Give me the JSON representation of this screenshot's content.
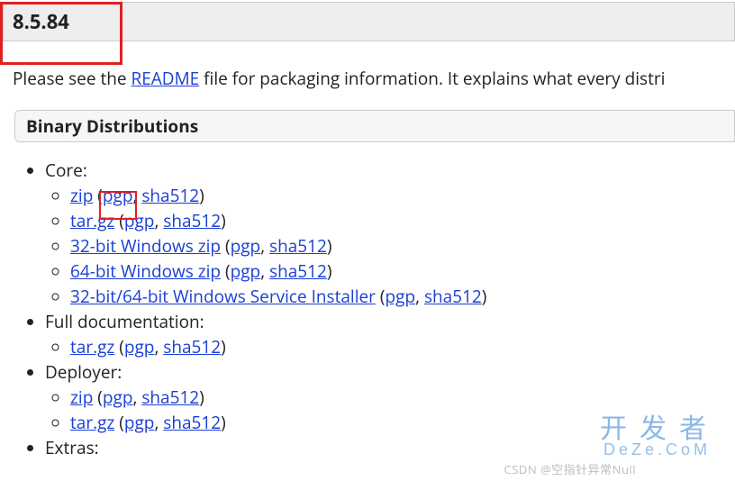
{
  "version": "8.5.84",
  "intro_prefix": "Please see the ",
  "intro_link": "README",
  "intro_suffix": " file for packaging information. It explains what every distri",
  "section_title": "Binary Distributions",
  "labels": {
    "pgp": "pgp",
    "sha512": "sha512"
  },
  "groups": [
    {
      "label": "Core:",
      "items": [
        {
          "name": "zip"
        },
        {
          "name": "tar.gz"
        },
        {
          "name": "32-bit Windows zip"
        },
        {
          "name": "64-bit Windows zip"
        },
        {
          "name": "32-bit/64-bit Windows Service Installer"
        }
      ]
    },
    {
      "label": "Full documentation:",
      "items": [
        {
          "name": "tar.gz"
        }
      ]
    },
    {
      "label": "Deployer:",
      "items": [
        {
          "name": "zip"
        },
        {
          "name": "tar.gz"
        }
      ]
    },
    {
      "label": "Extras:",
      "items": []
    }
  ],
  "watermark_main": "开发者",
  "watermark_sub": "DeZe.CoM",
  "watermark2": "CSDN @空指针异常Null"
}
